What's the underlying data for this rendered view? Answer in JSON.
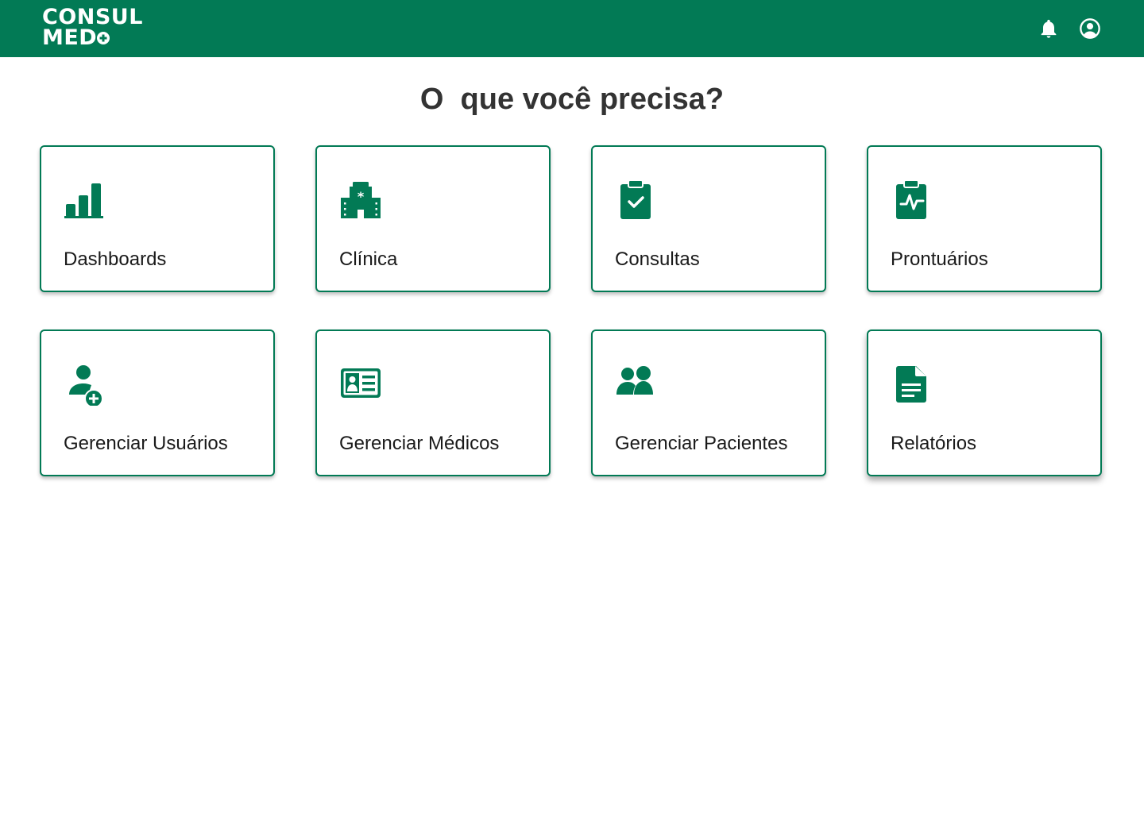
{
  "header": {
    "logo_line1": "CONSUL",
    "logo_line2": "MED",
    "brand_color": "#027A55",
    "icons": [
      "bell-icon",
      "account-circle-icon"
    ]
  },
  "main": {
    "title": "O  que você precisa?",
    "cards": [
      {
        "label": "Dashboards",
        "icon": "bar-chart-icon"
      },
      {
        "label": "Clínica",
        "icon": "hospital-icon"
      },
      {
        "label": "Consultas",
        "icon": "clipboard-check-icon"
      },
      {
        "label": "Prontuários",
        "icon": "clipboard-pulse-icon"
      },
      {
        "label": "Gerenciar Usuários",
        "icon": "person-add-icon"
      },
      {
        "label": "Gerenciar Médicos",
        "icon": "id-card-icon"
      },
      {
        "label": "Gerenciar Pacientes",
        "icon": "people-icon"
      },
      {
        "label": "Relatórios",
        "icon": "document-icon"
      }
    ]
  }
}
